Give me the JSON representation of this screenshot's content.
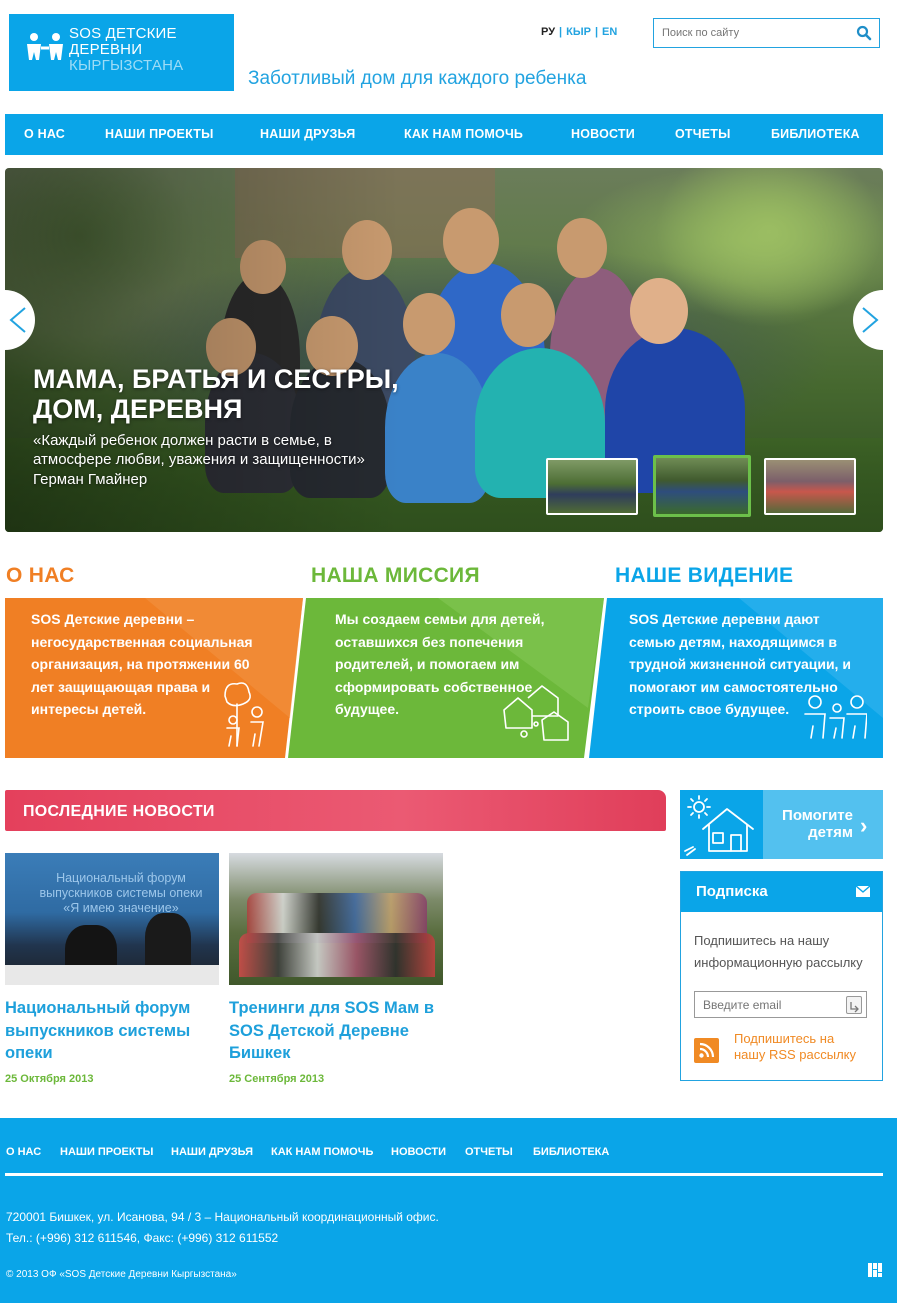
{
  "header": {
    "logo_line1": "SOS ДЕТСКИЕ",
    "logo_line2": "ДЕРЕВНИ",
    "logo_line3": "КЫРГЫЗСТАНА",
    "tagline": "Заботливый дом для каждого ребенка",
    "languages": [
      "РУ",
      "КЫР",
      "EN"
    ],
    "search_placeholder": "Поиск по сайту"
  },
  "nav": {
    "items": [
      "О НАС",
      "НАШИ ПРОЕКТЫ",
      "НАШИ ДРУЗЬЯ",
      "КАК НАМ ПОМОЧЬ",
      "НОВОСТИ",
      "ОТЧЕТЫ",
      "БИБЛИОТЕКА"
    ]
  },
  "hero": {
    "title_line1": "МАМА, БРАТЬЯ И СЕСТРЫ,",
    "title_line2": "ДОМ, ДЕРЕВНЯ",
    "quote_line1": "«Каждый ребенок должен расти в семье, в",
    "quote_line2": "атмосфере любви, уважения и защищенности»",
    "author": "Герман Гмайнер",
    "active_slide": 2
  },
  "columns": [
    {
      "title": "О НАС",
      "text": [
        "SOS Детские деревни –",
        "негосударственная социальная",
        "организация, на протяжении 60",
        "лет защищающая права и",
        "интересы детей."
      ],
      "color": "#f07f24"
    },
    {
      "title": "НАША МИССИЯ",
      "text": [
        "Мы создаем семьи для детей,",
        "оставшихся без попечения",
        "родителей, и помогаем им",
        "сформировать собственное",
        "будущее."
      ],
      "color": "#6cb83a"
    },
    {
      "title": "НАШЕ ВИДЕНИЕ",
      "text": [
        "SOS Детские деревни дают",
        "семью детям, находящимся в",
        "трудной жизненной ситуации, и",
        "помогают им самостоятельно",
        "строить свое будущее."
      ],
      "color": "#0aa5e8"
    }
  ],
  "news": {
    "heading": "ПОСЛЕДНИЕ НОВОСТИ",
    "items": [
      {
        "title_lines": [
          "Национальный форум",
          "выпускников системы",
          "опеки"
        ],
        "date": "25 Октября 2013",
        "image_text": [
          "Национальный форум",
          "выпускников системы опеки",
          "«Я имею значение»"
        ]
      },
      {
        "title_lines": [
          "Тренинги для SOS Мам в",
          "SOS Детской Деревне",
          "Бишкек"
        ],
        "date": "25 Сентября 2013"
      }
    ]
  },
  "sidebar": {
    "help_line1": "Помогите",
    "help_line2": "детям",
    "subscribe_title": "Подписка",
    "subscribe_desc_line1": "Подпишитесь на нашу",
    "subscribe_desc_line2": "информационную рассылку",
    "email_placeholder": "Введите email",
    "rss_line1": "Подпишитесь на",
    "rss_line2": "нашу RSS рассылку"
  },
  "footer": {
    "nav": [
      "О НАС",
      "НАШИ ПРОЕКТЫ",
      "НАШИ ДРУЗЬЯ",
      "КАК НАМ ПОМОЧЬ",
      "НОВОСТИ",
      "ОТЧЕТЫ",
      "БИБЛИОТЕКА"
    ],
    "address": "720001 Бишкек, ул. Исанова, 94 / 3 – Национальный координационный офис.",
    "phones": "Тел.: (+996) 312 611546, Факс: (+996) 312 611552",
    "copyright": "© 2013 ОФ «SOS Детские Деревни Кыргызстана»"
  },
  "colors": {
    "brand_blue": "#0aa5e8",
    "orange": "#f07f24",
    "green": "#6cb83a",
    "news_red": "#e4405c"
  },
  "icons": [
    "sos-logo-icon",
    "search-icon",
    "arrow-left-icon",
    "arrow-right-icon",
    "children-icon",
    "houses-icon",
    "family-icon",
    "house-sun-icon",
    "chevron-right-icon",
    "mail-icon",
    "rss-icon",
    "site-logo-icon"
  ]
}
